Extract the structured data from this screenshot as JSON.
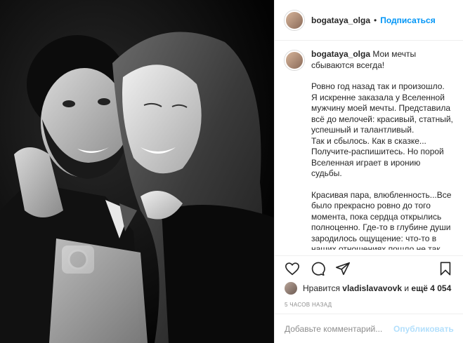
{
  "post": {
    "username": "bogataya_olga",
    "separator": "•",
    "follow_label": "Подписаться"
  },
  "caption": {
    "username": "bogataya_olga",
    "first_line": "Мои мечты сбываются всегда!",
    "paragraph_1": "Ровно год назад так и произошло.\nЯ искренне заказала у Вселенной мужчину моей мечты. Представила всё до мелочей: красивый, статный, успешный и талантливый.\nТак и сбылось. Как в сказке...\nПолучите-распишитесь. Но порой Вселенная играет в иронию судьбы.",
    "paragraph_2": "Красивая пара, влюбленность...Все было прекрасно ровно до того момента, пока сердца открылись полноценно. Где-то в глубине души зародилось ощущение: что-то в наших отношениях пошло не так.\nПостепенно начало приходить понимание, что в наших сердцах так"
  },
  "actions": {
    "like_icon": "heart-icon",
    "comment_icon": "comment-icon",
    "share_icon": "share-icon",
    "save_icon": "bookmark-icon"
  },
  "likes": {
    "prefix": "Нравится",
    "user": "vladislavavovk",
    "conjunction": "и",
    "others": "ещё 4 054"
  },
  "timestamp": "5 часов назад",
  "comment_box": {
    "placeholder": "Добавьте комментарий...",
    "post_label": "Опубликовать"
  },
  "colors": {
    "accent": "#0095f6",
    "post_disabled": "#b2dffc",
    "muted": "#8e8e8e",
    "border": "#efefef"
  }
}
